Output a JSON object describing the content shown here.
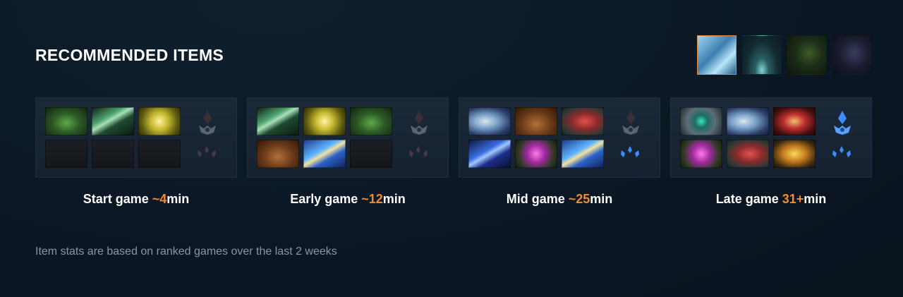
{
  "title": "RECOMMENDED ITEMS",
  "hero_thumbnails": [
    {
      "icon": "ice-hero-icon",
      "active": true
    },
    {
      "icon": "fountain-hero-icon",
      "active": false
    },
    {
      "icon": "hooded-hero-icon",
      "active": false
    },
    {
      "icon": "shadow-hero-icon",
      "active": false
    }
  ],
  "phases": [
    {
      "label": "Start game ",
      "time_prefix": "~",
      "time_value": "4",
      "time_unit": "min",
      "items": [
        "tango-icon",
        "magic-wand-icon",
        "circlet-icon",
        "empty",
        "empty",
        "empty"
      ],
      "shard_active": false,
      "scepter_active": false
    },
    {
      "label": "Early game ",
      "time_prefix": "~",
      "time_value": "12",
      "time_unit": "min",
      "items": [
        "magic-wand-icon",
        "circlet-icon",
        "tango-icon",
        "boots-icon",
        "blink-dagger-icon",
        "empty"
      ],
      "shard_active": false,
      "scepter_active": false
    },
    {
      "label": "Mid game ",
      "time_prefix": "~",
      "time_value": "25",
      "time_unit": "min",
      "items": [
        "axe-icon",
        "boots-icon",
        "red-blade-icon",
        "scepter-icon",
        "orb-icon",
        "blink-dagger-icon"
      ],
      "shard_active": false,
      "scepter_active": true
    },
    {
      "label": "Late game ",
      "time_prefix": "",
      "time_value": "31+",
      "time_unit": "min",
      "items": [
        "eye-icon",
        "axe-icon",
        "bow-icon",
        "orb-icon",
        "red-blade-icon",
        "gold-helm-icon"
      ],
      "shard_active": true,
      "scepter_active": true
    }
  ],
  "footnote": "Item stats are based on ranked games over the last 2 weeks",
  "colors": {
    "accent": "#f28a2e",
    "active_border": "#e08a3c",
    "inactive_upgrade": "#5a6470",
    "active_upgrade": "#3f8cff"
  }
}
